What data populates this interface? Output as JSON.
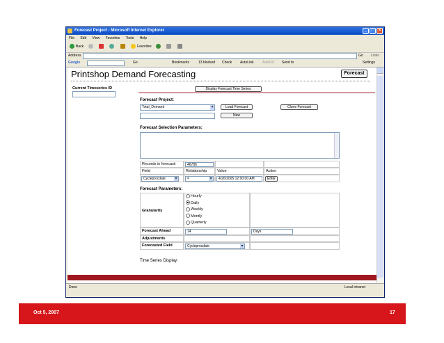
{
  "window": {
    "title": "Forecast Project - Microsoft Internet Explorer",
    "menu": [
      "File",
      "Edit",
      "View",
      "Favorites",
      "Tools",
      "Help"
    ],
    "toolbar": [
      "Back",
      "Favorites"
    ],
    "address_label": "Address",
    "go_label": "Go",
    "links_label": "Links",
    "googlebar": [
      "Google",
      "Go",
      "Bookmarks",
      "13 blocked",
      "Check",
      "AutoLink",
      "AutoFill",
      "Send to",
      "Settings"
    ],
    "status_left": "Done",
    "status_right": "Local intranet"
  },
  "page": {
    "heading": "Printshop Demand Forecasting",
    "forecast_button": "Forecast",
    "current_ts_label": "Current Timeseries ID",
    "display_ts_button": "Display Forecast Time Series",
    "forecast_project_label": "Forecast Project:",
    "project_select_value": "Total_Demand",
    "load_button": "Load Forecast",
    "clone_button": "Clone Forecast",
    "new_button": "New",
    "selection_label": "Forecast Selection Parameters:",
    "records_label": "Records in forecast:",
    "records_value": "46786",
    "col_headers": [
      "Field",
      "Relationship",
      "Value",
      "Action"
    ],
    "field_value": "Cycleprocdate",
    "relationship_value": "=",
    "date_value": "4/26/2005 12:00:00 AM",
    "enter_button": "Enter",
    "params_label": "Forecast Parameters:",
    "granularity_label": "Granularity",
    "granularity_options": [
      "Hourly",
      "Daily",
      "Weekly",
      "Montly",
      "Quarterly"
    ],
    "granularity_selected": "Daily",
    "ahead_label": "Forecast Ahead",
    "ahead_value": "14",
    "days_value": "Days",
    "adjustments_label": "Adjustments",
    "forecasted_field_label": "Forecasted Field",
    "forecasted_field_value": "Cycleprocdate",
    "ts_display_label": "Time Series Display:"
  },
  "slide": {
    "date": "Oct 5, 2007",
    "page_number": "17"
  },
  "colors": {
    "accent": "#d6161a",
    "dark_red": "#a0171f",
    "title_blue": "#0a4bc4"
  }
}
